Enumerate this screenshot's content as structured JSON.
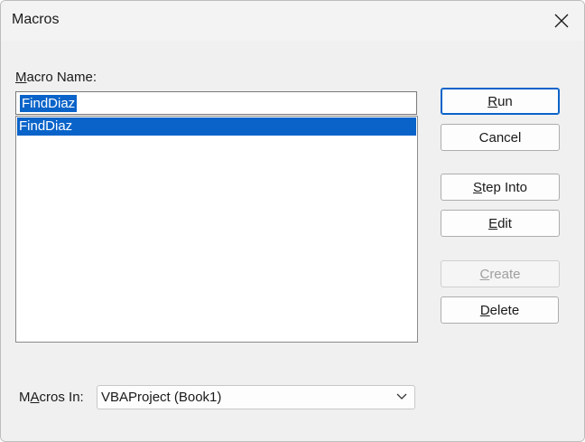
{
  "window": {
    "title": "Macros",
    "close_icon": "close-icon"
  },
  "macro_name": {
    "label_prefix": "",
    "label_mnemonic": "M",
    "label_rest": "acro Name:",
    "value": "FindDiaz"
  },
  "macro_list": {
    "items": [
      "FindDiaz"
    ],
    "selected_index": 0
  },
  "buttons": {
    "run": {
      "mnemonic": "R",
      "rest": "un"
    },
    "cancel": {
      "label": "Cancel"
    },
    "step_into": {
      "mnemonic": "S",
      "rest": "tep Into"
    },
    "edit": {
      "mnemonic": "E",
      "rest": "dit"
    },
    "create": {
      "mnemonic": "C",
      "rest": "reate"
    },
    "delete": {
      "mnemonic": "D",
      "rest": "elete"
    }
  },
  "macros_in": {
    "label_prefix": "",
    "label_mnemonic": "A",
    "label_start": "M",
    "label_rest": "cros In:",
    "value": "VBAProject (Book1)",
    "dropdown_icon": "chevron-down-icon"
  },
  "colors": {
    "selection": "#0a63c9",
    "dialog_bg": "#f0f0f0"
  }
}
